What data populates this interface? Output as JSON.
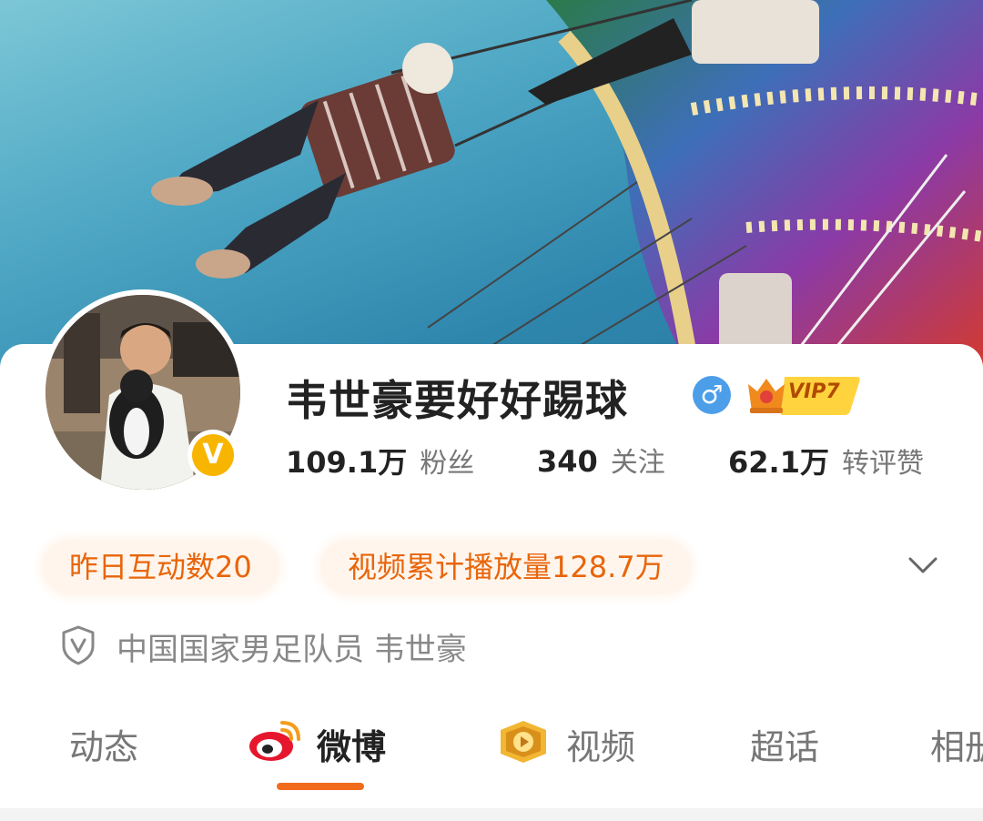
{
  "profile": {
    "username": "韦世豪要好好踢球",
    "vip_level": "VIP7",
    "gender": "male",
    "verified_badge": "V"
  },
  "stats": [
    {
      "value": "109.1万",
      "label": "粉丝"
    },
    {
      "value": "340",
      "label": "关注"
    },
    {
      "value": "62.1万",
      "label": "转评赞"
    }
  ],
  "chips": {
    "interactions": "昨日互动数20",
    "video_plays": "视频累计播放量128.7万"
  },
  "verification": {
    "text": "中国国家男足队员 韦世豪"
  },
  "tabs": [
    {
      "label": "动态",
      "active": false
    },
    {
      "label": "微博",
      "active": true,
      "icon": "weibo-logo-icon"
    },
    {
      "label": "视频",
      "active": false,
      "icon": "video-play-icon"
    },
    {
      "label": "超话",
      "active": false
    },
    {
      "label": "相册",
      "active": false
    }
  ],
  "colors": {
    "accent": "#f26b1d",
    "chip_text": "#e8650b",
    "chip_bg": "#fff5ec",
    "gender_blue": "#4d9ee8",
    "verified_gold": "#f7b500"
  },
  "icons": {
    "expand": "chevron-down-icon",
    "verification": "shield-v-icon"
  }
}
